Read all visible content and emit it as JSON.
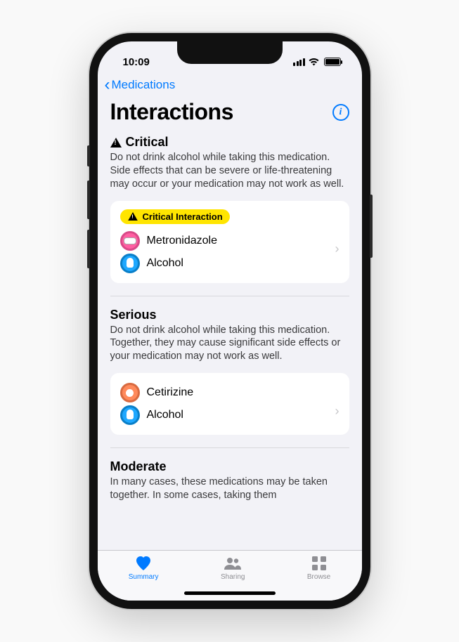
{
  "status": {
    "time": "10:09"
  },
  "nav": {
    "back_label": "Medications"
  },
  "title": "Interactions",
  "sections": {
    "critical": {
      "header": "Critical",
      "body": "Do not drink alcohol while taking this medication. Side effects that can be severe or life-threatening may occur or your medication may not work as well.",
      "badge": "Critical Interaction",
      "med1": "Metronidazole",
      "med2": "Alcohol"
    },
    "serious": {
      "header": "Serious",
      "body": "Do not drink alcohol while taking this medication. Together, they may cause significant side effects or your medication may not work as well.",
      "med1": "Cetirizine",
      "med2": "Alcohol"
    },
    "moderate": {
      "header": "Moderate",
      "body": "In many cases, these medications may be taken together. In some cases, taking them"
    }
  },
  "tabs": {
    "summary": "Summary",
    "sharing": "Sharing",
    "browse": "Browse"
  }
}
